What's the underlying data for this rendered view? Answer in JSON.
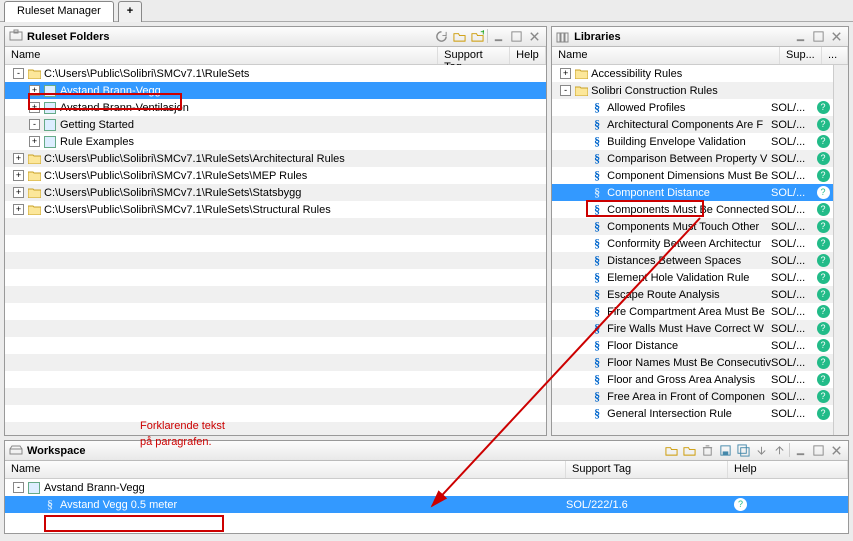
{
  "tabs": {
    "main": "Ruleset Manager",
    "plus": "+"
  },
  "leftPanel": {
    "title": "Ruleset Folders",
    "cols": {
      "name": "Name",
      "sup": "Support Tag",
      "help": "Help"
    },
    "rows": [
      {
        "indent": 0,
        "exp": "-",
        "icon": "folder",
        "text": "C:\\Users\\Public\\Solibri\\SMCv7.1\\RuleSets"
      },
      {
        "indent": 1,
        "exp": "+",
        "icon": "ruleset",
        "text": "Avstand Brann-Vegg",
        "sel": true
      },
      {
        "indent": 1,
        "exp": "+",
        "icon": "ruleset",
        "text": "Avstand Brann-Ventilasjon"
      },
      {
        "indent": 1,
        "exp": "-",
        "icon": "ruleset",
        "text": "Getting Started"
      },
      {
        "indent": 1,
        "exp": "+",
        "icon": "ruleset",
        "text": "Rule Examples"
      },
      {
        "indent": 0,
        "exp": "+",
        "icon": "folder",
        "text": "C:\\Users\\Public\\Solibri\\SMCv7.1\\RuleSets\\Architectural Rules"
      },
      {
        "indent": 0,
        "exp": "+",
        "icon": "folder",
        "text": "C:\\Users\\Public\\Solibri\\SMCv7.1\\RuleSets\\MEP Rules"
      },
      {
        "indent": 0,
        "exp": "+",
        "icon": "folder",
        "text": "C:\\Users\\Public\\Solibri\\SMCv7.1\\RuleSets\\Statsbygg"
      },
      {
        "indent": 0,
        "exp": "+",
        "icon": "folder",
        "text": "C:\\Users\\Public\\Solibri\\SMCv7.1\\RuleSets\\Structural Rules"
      }
    ]
  },
  "rightPanel": {
    "title": "Libraries",
    "cols": {
      "name": "Name",
      "sup": "Sup...",
      "help": "..."
    },
    "rows": [
      {
        "indent": 0,
        "exp": "+",
        "icon": "folder",
        "text": "Accessibility Rules"
      },
      {
        "indent": 0,
        "exp": "-",
        "icon": "folder",
        "text": "Solibri Construction Rules"
      },
      {
        "indent": 1,
        "icon": "rule",
        "text": "Allowed Profiles",
        "sup": "SOL/...",
        "help": true
      },
      {
        "indent": 1,
        "icon": "rule",
        "text": "Architectural Components Are F",
        "sup": "SOL/...",
        "help": true
      },
      {
        "indent": 1,
        "icon": "rule",
        "text": "Building Envelope Validation",
        "sup": "SOL/...",
        "help": true
      },
      {
        "indent": 1,
        "icon": "rule",
        "text": "Comparison Between Property V",
        "sup": "SOL/...",
        "help": true
      },
      {
        "indent": 1,
        "icon": "rule",
        "text": "Component Dimensions Must Be",
        "sup": "SOL/...",
        "help": true
      },
      {
        "indent": 1,
        "icon": "rule",
        "text": "Component Distance",
        "sup": "SOL/...",
        "help": true,
        "sel": true
      },
      {
        "indent": 1,
        "icon": "rule",
        "text": "Components Must Be Connected",
        "sup": "SOL/...",
        "help": true
      },
      {
        "indent": 1,
        "icon": "rule",
        "text": "Components Must Touch Other",
        "sup": "SOL/...",
        "help": true
      },
      {
        "indent": 1,
        "icon": "rule",
        "text": "Conformity Between Architectur",
        "sup": "SOL/...",
        "help": true
      },
      {
        "indent": 1,
        "icon": "rule",
        "text": "Distances Between Spaces",
        "sup": "SOL/...",
        "help": true
      },
      {
        "indent": 1,
        "icon": "rule",
        "text": "Element Hole Validation Rule",
        "sup": "SOL/...",
        "help": true
      },
      {
        "indent": 1,
        "icon": "rule",
        "text": "Escape Route Analysis",
        "sup": "SOL/...",
        "help": true
      },
      {
        "indent": 1,
        "icon": "rule",
        "text": "Fire Compartment Area Must Be",
        "sup": "SOL/...",
        "help": true
      },
      {
        "indent": 1,
        "icon": "rule",
        "text": "Fire Walls Must Have Correct W",
        "sup": "SOL/...",
        "help": true
      },
      {
        "indent": 1,
        "icon": "rule",
        "text": "Floor Distance",
        "sup": "SOL/...",
        "help": true
      },
      {
        "indent": 1,
        "icon": "rule",
        "text": "Floor Names Must Be Consecutiv",
        "sup": "SOL/...",
        "help": true
      },
      {
        "indent": 1,
        "icon": "rule",
        "text": "Floor and Gross Area Analysis",
        "sup": "SOL/...",
        "help": true
      },
      {
        "indent": 1,
        "icon": "rule",
        "text": "Free Area in Front of Componen",
        "sup": "SOL/...",
        "help": true
      },
      {
        "indent": 1,
        "icon": "rule",
        "text": "General Intersection Rule",
        "sup": "SOL/...",
        "help": true
      }
    ]
  },
  "workspace": {
    "title": "Workspace",
    "cols": {
      "name": "Name",
      "sup": "Support Tag",
      "help": "Help"
    },
    "rows": [
      {
        "indent": 0,
        "exp": "-",
        "icon": "ruleset",
        "text": "Avstand Brann-Vegg"
      },
      {
        "indent": 1,
        "icon": "rule",
        "text": "Avstand Vegg 0.5 meter",
        "sup": "SOL/222/1.6",
        "help": true,
        "sel": true
      }
    ]
  },
  "annotation": {
    "line1": "Forklarende tekst",
    "line2": "på paragrafen."
  }
}
